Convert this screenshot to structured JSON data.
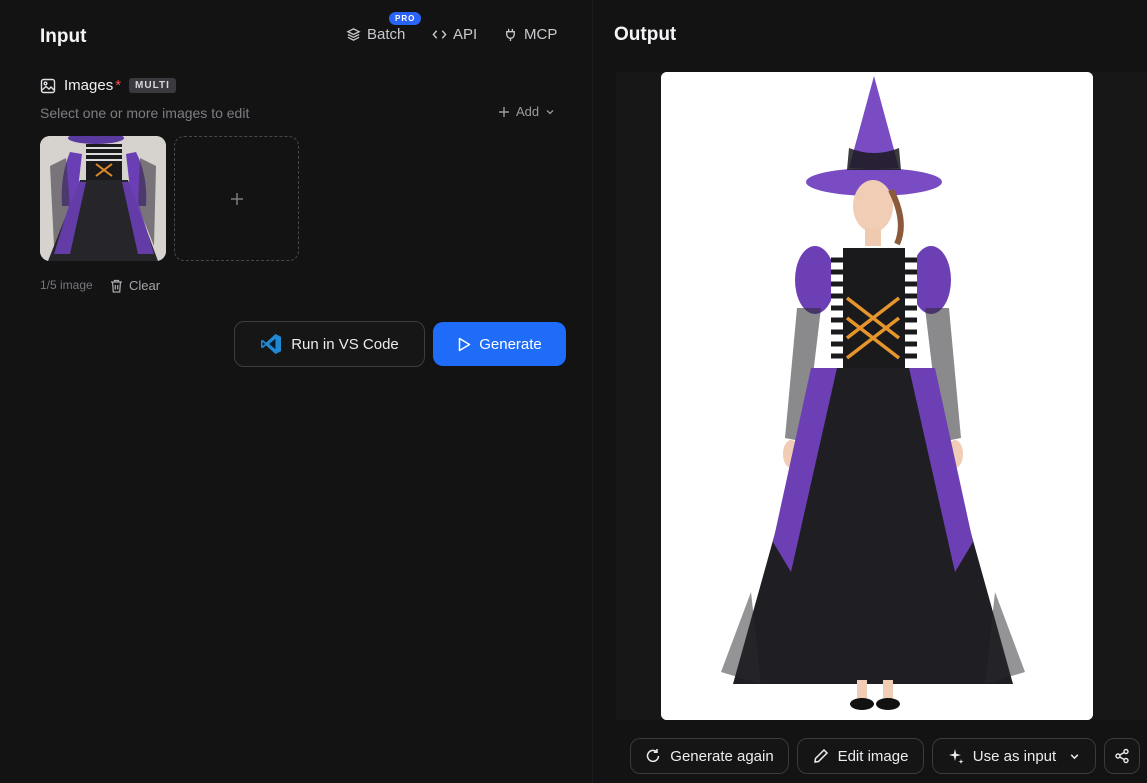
{
  "input": {
    "title": "Input",
    "nav": [
      {
        "label": "Batch",
        "icon": "layers-icon"
      },
      {
        "label": "API",
        "icon": "code-icon"
      },
      {
        "label": "MCP",
        "icon": "plug-icon"
      }
    ],
    "pro_badge": "PRO",
    "images_label": "Images",
    "required_mark": "*",
    "multi_badge": "MULTI",
    "hint": "Select one or more images to edit",
    "add_label": "Add",
    "count_label": "1/5 image",
    "clear_label": "Clear",
    "run_vscode_label": "Run in VS Code",
    "generate_label": "Generate"
  },
  "output": {
    "title": "Output",
    "actions": [
      {
        "label": "Generate again",
        "icon": "refresh-icon"
      },
      {
        "label": "Edit image",
        "icon": "pencil-icon"
      },
      {
        "label": "Use as input",
        "icon": "sparkle-icon"
      }
    ]
  },
  "colors": {
    "accent": "#1e6cf7",
    "background": "#131314",
    "required": "#ff4d4f"
  }
}
